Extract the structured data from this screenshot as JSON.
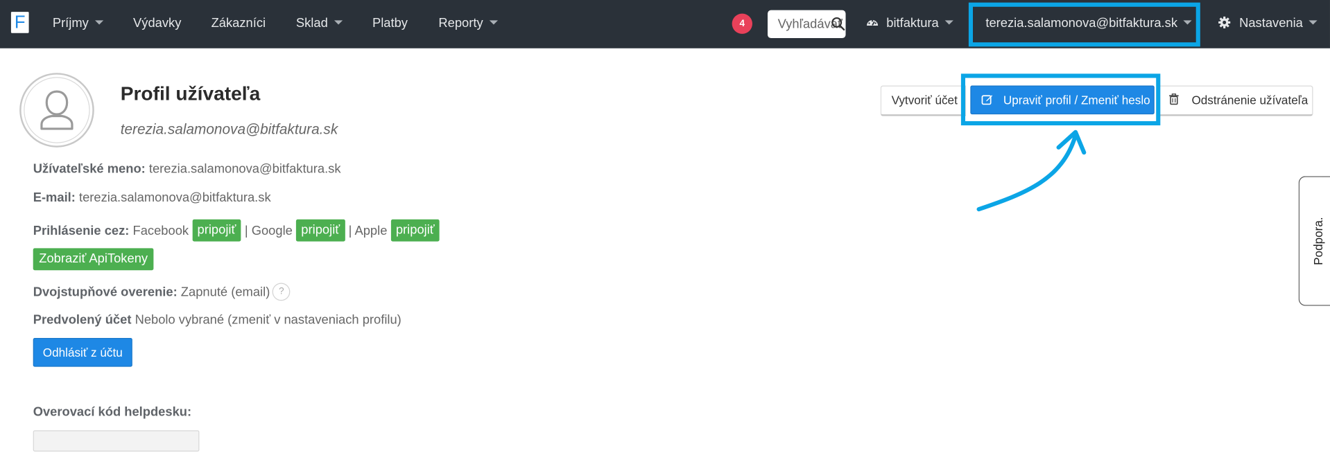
{
  "nav": {
    "logo_letter": "F",
    "items": [
      "Príjmy",
      "Výdavky",
      "Zákazníci",
      "Sklad",
      "Platby",
      "Reporty"
    ],
    "notifications": "4",
    "search_placeholder": "Vyhľadávať",
    "company": "bitfaktura",
    "user_email": "terezia.salamonova@bitfaktura.sk",
    "settings": "Nastavenia"
  },
  "profile": {
    "title": "Profil užívateľa",
    "subtitle_email": "terezia.salamonova@bitfaktura.sk",
    "username_label": "Užívateľské meno:",
    "username_value": "terezia.salamonova@bitfaktura.sk",
    "email_label": "E-mail:",
    "email_value": "terezia.salamonova@bitfaktura.sk",
    "login_label": "Prihlásenie cez:",
    "login_providers": [
      {
        "name": "Facebook",
        "action": "pripojiť"
      },
      {
        "name": "Google",
        "action": "pripojiť"
      },
      {
        "name": "Apple",
        "action": "pripojiť"
      }
    ],
    "separator": "|",
    "api_tokens_button": "Zobraziť ApiTokeny",
    "twofa_label": "Dvojstupňové overenie:",
    "twofa_value": "Zapnuté (email)",
    "help_mark": "?",
    "default_account_label": "Predvolený účet",
    "default_account_value": "Nebolo vybrané (zmeniť v nastaveniach profilu)",
    "logout_button": "Odhlásiť z účtu",
    "helpdesk_label": "Overovací kód helpdesku:",
    "helpdesk_value": ""
  },
  "actions": {
    "create_account": "Vytvoriť účet",
    "edit_profile": "Upraviť profil / Zmeniť heslo",
    "delete_user": "Odstránenie užívateľa"
  },
  "support": {
    "label": "Podpora."
  },
  "colors": {
    "navbar": "#2a3139",
    "highlight": "#0ba5e6",
    "primary": "#1e88e5",
    "success": "#4caf50",
    "badge": "#e9415a"
  }
}
